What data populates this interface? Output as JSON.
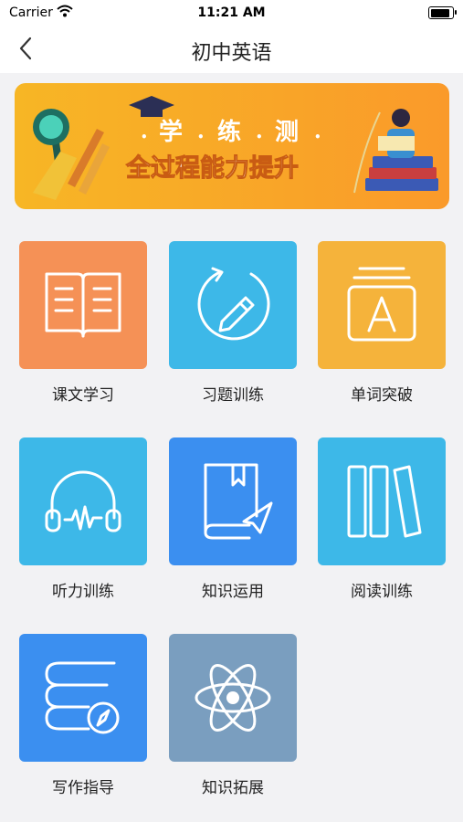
{
  "status_bar": {
    "carrier": "Carrier",
    "time": "11:21 AM"
  },
  "nav": {
    "title": "初中英语"
  },
  "banner": {
    "slogan_chars": [
      "学",
      "练",
      "测"
    ],
    "subtitle": "全过程能力提升"
  },
  "menu": [
    {
      "label": "课文学习",
      "icon": "open-book-icon",
      "color": "#f59156"
    },
    {
      "label": "习题训练",
      "icon": "pencil-circle-icon",
      "color": "#3db8e8"
    },
    {
      "label": "单词突破",
      "icon": "word-card-icon",
      "color": "#f5b33b"
    },
    {
      "label": "听力训练",
      "icon": "headphones-icon",
      "color": "#3db8e8"
    },
    {
      "label": "知识运用",
      "icon": "book-paper-plane-icon",
      "color": "#3b8ff0"
    },
    {
      "label": "阅读训练",
      "icon": "books-shelf-icon",
      "color": "#3db8e8"
    },
    {
      "label": "写作指导",
      "icon": "books-compass-icon",
      "color": "#3b8ff0"
    },
    {
      "label": "知识拓展",
      "icon": "atom-icon",
      "color": "#7a9ebf"
    }
  ]
}
